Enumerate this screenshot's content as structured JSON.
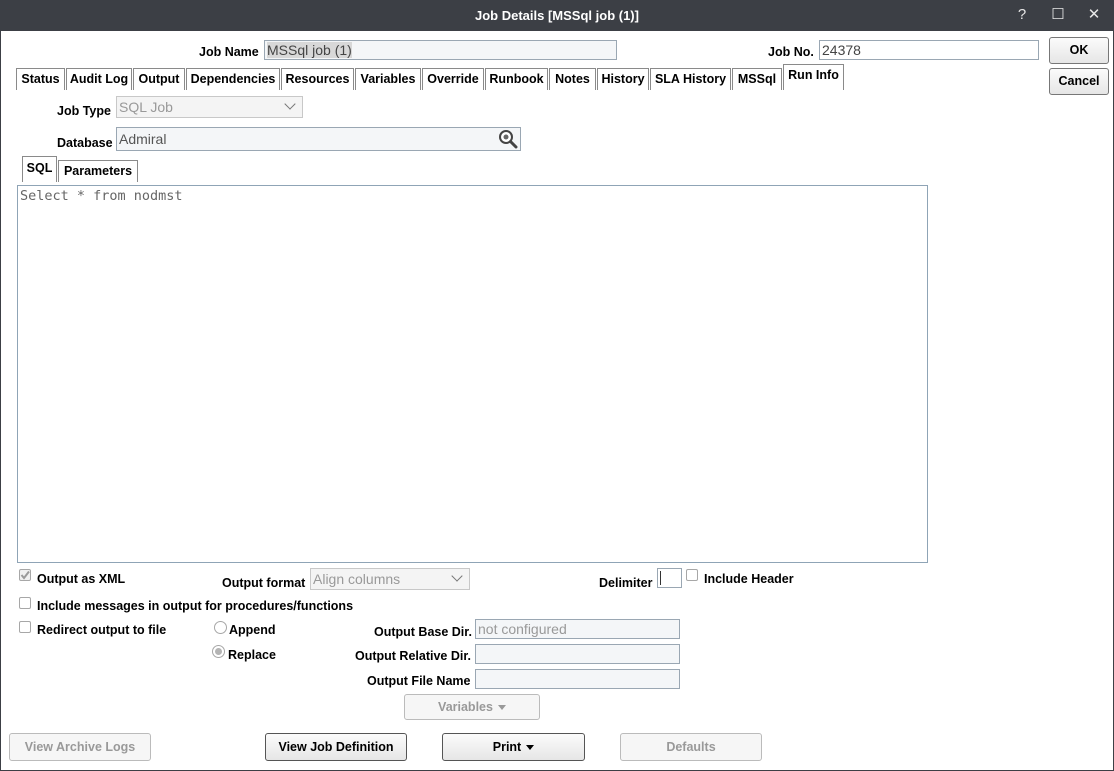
{
  "window": {
    "title": "Job Details [MSSql job (1)]",
    "help": "?",
    "maximize": "☐",
    "close": "✕"
  },
  "header": {
    "job_name_label": "Job Name",
    "job_name_value": "MSSql job (1)",
    "job_no_label": "Job No.",
    "job_no_value": "24378",
    "ok": "OK",
    "cancel": "Cancel"
  },
  "tabs": [
    {
      "label": "Status"
    },
    {
      "label": "Audit Log"
    },
    {
      "label": "Output"
    },
    {
      "label": "Dependencies"
    },
    {
      "label": "Resources"
    },
    {
      "label": "Variables"
    },
    {
      "label": "Override"
    },
    {
      "label": "Runbook"
    },
    {
      "label": "Notes"
    },
    {
      "label": "History"
    },
    {
      "label": "SLA History"
    },
    {
      "label": "MSSql"
    },
    {
      "label": "Run Info"
    }
  ],
  "run_info": {
    "job_type_label": "Job Type",
    "job_type_value": "SQL Job",
    "database_label": "Database",
    "database_value": "Admiral",
    "subtabs": [
      {
        "label": "SQL"
      },
      {
        "label": "Parameters"
      }
    ],
    "sql_text": "Select * from nodmst"
  },
  "options": {
    "output_xml_label": "Output as XML",
    "output_format_label": "Output format",
    "output_format_value": "Align columns",
    "delimiter_label": "Delimiter",
    "include_header_label": "Include Header",
    "include_messages_label": "Include messages in output for procedures/functions",
    "redirect_label": "Redirect output to file",
    "append_label": "Append",
    "replace_label": "Replace",
    "base_dir_label": "Output Base Dir.",
    "base_dir_value": "not configured",
    "relative_dir_label": "Output Relative Dir.",
    "file_name_label": "Output File Name",
    "variables_button": "Variables"
  },
  "footer": {
    "view_archive_logs": "View Archive Logs",
    "view_job_definition": "View Job Definition",
    "print": "Print",
    "defaults": "Defaults"
  }
}
